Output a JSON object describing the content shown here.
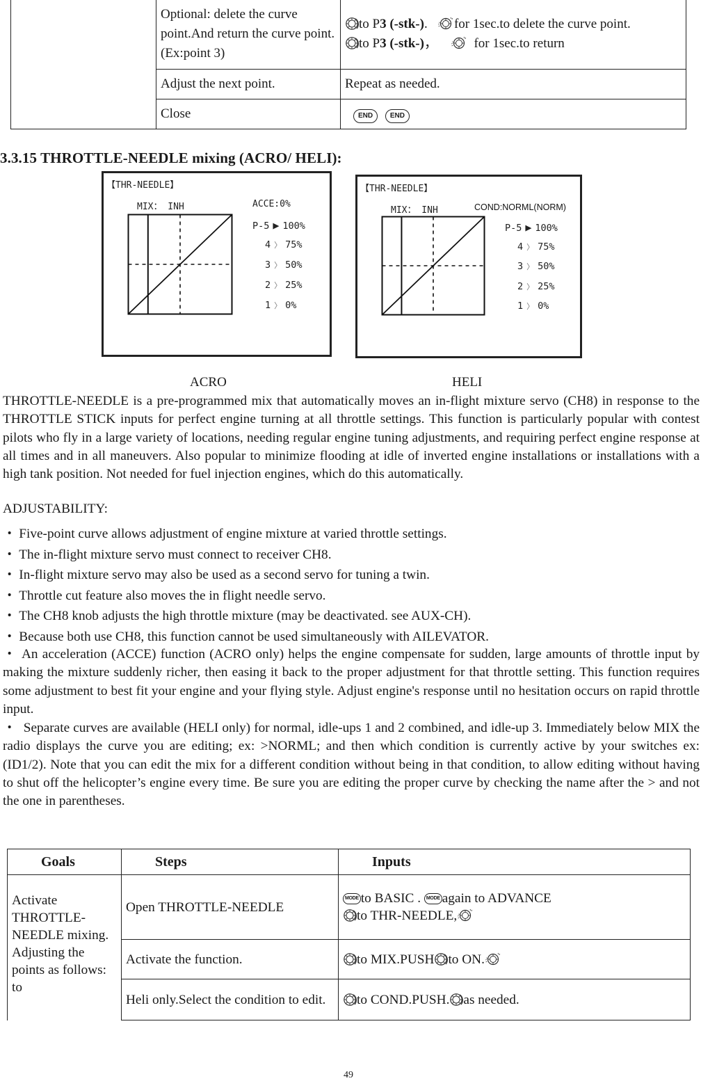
{
  "top_table": {
    "rows": [
      {
        "step": "Optional: delete the curve point.And return the curve point.(Ex:point 3)",
        "input_line1": [
          {
            "icon": "dial-rotate-icon"
          },
          {
            "text": "to P"
          },
          {
            "bold": "3 (-stk-)"
          },
          {
            "text": ".  "
          },
          {
            "icon": "dial-press-icon"
          },
          {
            "text": "for 1sec.to delete the curve point."
          }
        ],
        "input_line2": [
          {
            "icon": "dial-rotate-icon"
          },
          {
            "text": "to P"
          },
          {
            "bold": "3 (-stk-)"
          },
          {
            "text": "，   "
          },
          {
            "icon": "dial-press-icon"
          },
          {
            "text": "  for 1sec.to return"
          }
        ]
      },
      {
        "step": "Adjust the next point.",
        "input": "Repeat as needed."
      },
      {
        "step": "Close",
        "buttons": [
          "END",
          "END"
        ]
      }
    ]
  },
  "section": {
    "heading": "3.3.15 THROTTLE-NEEDLE mixing (ACRO/ HELI):"
  },
  "screens": [
    {
      "id": "acro",
      "title": "【THR-NEEDLE】",
      "mix": "MIX： INH",
      "status": "ACCE:0%",
      "points": [
        {
          "label": "P-5",
          "marker": "▶",
          "value": "100%"
        },
        {
          "label": "4",
          "marker": "〉",
          "value": "75%"
        },
        {
          "label": "3",
          "marker": "〉",
          "value": "50%"
        },
        {
          "label": "2",
          "marker": "〉",
          "value": "25%"
        },
        {
          "label": "1",
          "marker": "〉",
          "value": "0%"
        }
      ],
      "caption": "ACRO"
    },
    {
      "id": "heli",
      "title": "【THR-NEEDLE】",
      "mix": "MIX： INH",
      "status": "COND:NORML(NORM)",
      "points": [
        {
          "label": "P-5",
          "marker": "▶",
          "value": "100%"
        },
        {
          "label": "4",
          "marker": "〉",
          "value": "75%"
        },
        {
          "label": "3",
          "marker": "〉",
          "value": "50%"
        },
        {
          "label": "2",
          "marker": "〉",
          "value": "25%"
        },
        {
          "label": "1",
          "marker": "〉",
          "value": "0%"
        }
      ],
      "caption": "HELI"
    }
  ],
  "chart_data": [
    {
      "type": "line",
      "title": "THR-NEEDLE (ACRO)",
      "x": [
        0,
        25,
        50,
        75,
        100
      ],
      "series": [
        {
          "name": "curve",
          "values": [
            0,
            25,
            50,
            75,
            100
          ]
        }
      ],
      "xlim": [
        0,
        100
      ],
      "ylim": [
        0,
        100
      ],
      "stick_position": 19,
      "center_crosshair": [
        50,
        50
      ]
    },
    {
      "type": "line",
      "title": "THR-NEEDLE (HELI)",
      "x": [
        0,
        25,
        50,
        75,
        100
      ],
      "series": [
        {
          "name": "curve",
          "values": [
            0,
            25,
            50,
            75,
            100
          ]
        }
      ],
      "xlim": [
        0,
        100
      ],
      "ylim": [
        0,
        100
      ],
      "stick_position": 19,
      "center_crosshair": [
        50,
        50
      ]
    }
  ],
  "intro": "THROTTLE-NEEDLE is a pre-programmed mix that automatically moves an in-flight mixture servo (CH8) in response to the THROTTLE STICK inputs for perfect engine turning at all throttle settings. This function is particularly popular with contest pilots who fly in a large variety of locations, needing regular engine tuning adjustments, and requiring perfect engine response at all times and in all maneuvers. Also popular to minimize flooding at idle of inverted engine installations or installations with a high tank position. Not needed for fuel injection engines, which do this automatically.",
  "adjustability": {
    "heading": "ADJUSTABILITY:",
    "bullet_char": "・",
    "bullets": [
      "Five-point curve allows adjustment of engine mixture at varied throttle settings.",
      "The in-flight mixture servo must connect to receiver CH8.",
      "In-flight mixture servo may also be used as a second servo for tuning a twin.",
      "Throttle cut feature also moves the in flight needle servo.",
      "The CH8 knob adjusts the high throttle mixture (may be deactivated. see AUX-CH).",
      "Because both use CH8, this function cannot be used simultaneously with AILEVATOR."
    ],
    "paragraph_acce": "An acceleration (ACCE) function (ACRO only) helps the engine compensate for sudden, large amounts of throttle input by making the mixture suddenly richer, then easing it back to the proper adjustment for that throttle setting. This function requires some adjustment to best fit your engine and your flying style. Adjust engine's response until no hesitation occurs on rapid throttle input.",
    "paragraph_heli": "Separate curves are available (HELI only) for normal, idle-ups 1 and 2 combined, and idle-up 3. Immediately below MIX the radio displays the curve you are editing; ex: >NORML; and then which condition is currently active by your switches ex: (ID1/2). Note that you can edit the mix for a different condition without being in that condition, to allow editing without having to shut off the helicopter’s engine every time. Be sure you are editing the proper curve by checking the name after the > and not the one in parentheses."
  },
  "bottom_table": {
    "headers": [
      "Goals",
      "Steps",
      "Inputs"
    ],
    "goal": "Activate THROTTLE-NEEDLE mixing. Adjusting the points as follows: to",
    "rows": [
      {
        "step": "Open THROTTLE-NEEDLE",
        "line1_a": "to BASIC .",
        "line1_b": "again to ADVANCE",
        "line2": "to THR-NEEDLE,"
      },
      {
        "step": "Activate the function.",
        "line1_a": "to MIX.PUSH",
        "line1_b": "to ON."
      },
      {
        "step": "Heli only.Select the condition to edit.",
        "line1_a": "to COND.PUSH.",
        "line1_b": "as needed."
      }
    ],
    "mode_button_label": "MODE"
  },
  "page_number": "49"
}
